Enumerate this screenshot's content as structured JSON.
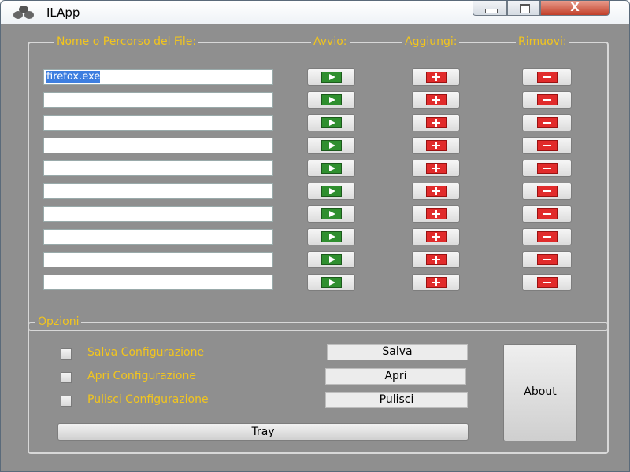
{
  "window": {
    "title": "ILApp",
    "close_glyph": "X"
  },
  "files": {
    "legend_name": "Nome o Percorso del File:",
    "legend_run": "Avvio:",
    "legend_add": "Aggiungi:",
    "legend_remove": "Rimuovi:",
    "rows": [
      {
        "value": "firefox.exe"
      },
      {
        "value": ""
      },
      {
        "value": ""
      },
      {
        "value": ""
      },
      {
        "value": ""
      },
      {
        "value": ""
      },
      {
        "value": ""
      },
      {
        "value": ""
      },
      {
        "value": ""
      },
      {
        "value": ""
      }
    ],
    "icons": {
      "run": "play-icon",
      "add": "plus-icon",
      "remove": "minus-icon"
    },
    "colors": {
      "run": "#2f8f2f",
      "add": "#e12b2b",
      "remove": "#e12b2b"
    }
  },
  "options": {
    "legend": "Opzioni",
    "save_checkbox_label": "Salva Configurazione",
    "open_checkbox_label": "Apri Configurazione",
    "clear_checkbox_label": "Pulisci Configurazione",
    "save_button": "Salva",
    "open_button": "Apri",
    "clear_button": "Pulisci",
    "about_button": "About",
    "tray_button": "Tray",
    "label_color": "#f2c51e"
  }
}
